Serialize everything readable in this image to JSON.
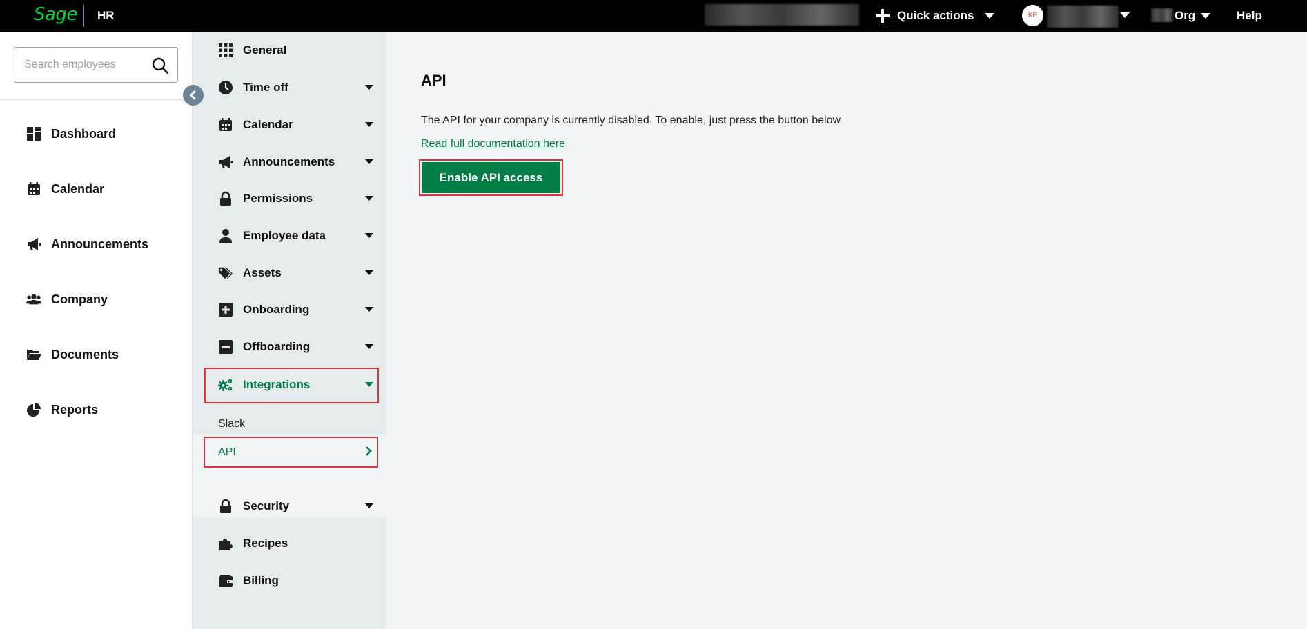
{
  "topbar": {
    "logo": "Sage",
    "product": "HR",
    "quick_actions": "Quick actions",
    "avatar_initials": "KP",
    "org": "Org",
    "help": "Help"
  },
  "search": {
    "placeholder": "Search employees"
  },
  "main_nav": [
    {
      "label": "Dashboard",
      "icon": "dashboard-icon"
    },
    {
      "label": "Calendar",
      "icon": "calendar-icon"
    },
    {
      "label": "Announcements",
      "icon": "megaphone-icon"
    },
    {
      "label": "Company",
      "icon": "users-icon"
    },
    {
      "label": "Documents",
      "icon": "folder-icon"
    },
    {
      "label": "Reports",
      "icon": "pie-chart-icon"
    }
  ],
  "settings_nav": [
    {
      "label": "General",
      "icon": "grid-icon"
    },
    {
      "label": "Time off",
      "icon": "clock-icon"
    },
    {
      "label": "Calendar",
      "icon": "calendar-icon"
    },
    {
      "label": "Announcements",
      "icon": "megaphone-icon"
    },
    {
      "label": "Permissions",
      "icon": "lock-icon"
    },
    {
      "label": "Employee data",
      "icon": "user-icon"
    },
    {
      "label": "Assets",
      "icon": "tags-icon"
    },
    {
      "label": "Onboarding",
      "icon": "plus-square-icon"
    },
    {
      "label": "Offboarding",
      "icon": "minus-square-icon"
    },
    {
      "label": "Integrations",
      "icon": "cogs-icon",
      "active": true
    },
    {
      "label": "Security",
      "icon": "lock-icon"
    },
    {
      "label": "Recipes",
      "icon": "puzzle-icon"
    },
    {
      "label": "Billing",
      "icon": "wallet-icon"
    }
  ],
  "integrations_sub": [
    {
      "label": "Slack"
    },
    {
      "label": "API",
      "active": true
    }
  ],
  "content": {
    "title": "API",
    "description": "The API for your company is currently disabled. To enable, just press the button below",
    "doc_link": "Read full documentation here",
    "button": "Enable API access"
  },
  "colors": {
    "accent": "#007e45",
    "highlight": "#e0333a",
    "topbar": "#000000",
    "logo": "#00d639"
  }
}
